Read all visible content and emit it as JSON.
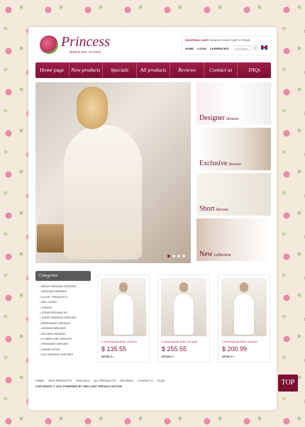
{
  "logo": {
    "name": "Princess",
    "tagline": "WEDDING STORE"
  },
  "cart": {
    "label": "SHOPPING CART:",
    "status": " NOW IN YOUR CART 0 ITEMS",
    "links": [
      "HOME",
      "LOGIN",
      "CURRENCIES"
    ],
    "currency_value": "US Dollar",
    "currency_arrow": "▾"
  },
  "nav": [
    "Home page",
    "New products",
    "Specials",
    "All products",
    "Reviews",
    "Contact us",
    "FAQs"
  ],
  "promos": [
    {
      "title": "Designer",
      "sub": "dresses"
    },
    {
      "title": "Exclusive",
      "sub": "dresses"
    },
    {
      "title": "Short",
      "sub": "dresses"
    },
    {
      "title": "New",
      "sub": "collection"
    }
  ],
  "slider": {
    "dots": 4,
    "active": 0
  },
  "categories": {
    "title": "Categories",
    "items": [
      "BEACH WEDDING DRESSES",
      "WEDDING DRESSES",
      "A-LINE / PRINCESS &",
      "BALL GOWN",
      "SHEATH",
      "STRAPLESS/HALTER",
      "SHORT WEDDING DRESSES",
      "BRIDESMAID DRESSES",
      "EVENING DRESSES",
      "MOTHER DRESSES",
      "FLOWER GIRL DRESSES",
      "PREGNANT DRESSES",
      "GRAND STOCK",
      "2011 WEDDING DRESSES"
    ]
  },
  "products": [
    {
      "desc": "Lorem ipsum dolor sit amet",
      "price": "$ 135.55",
      "details": "DETAILS »"
    },
    {
      "desc": "Lorem ipsum dolor sit amet",
      "price": "$ 255.55",
      "details": "DETAILS »"
    },
    {
      "desc": "Lorem ipsum dolor sit amet",
      "price": "$ 200.99",
      "details": "DETAILS »"
    }
  ],
  "footer": {
    "links": [
      "HOME",
      "NEW PRODUCTS",
      "SPECIALS",
      "ALL PRODUCTS",
      "REVIEWS",
      "CONTACTS",
      "FAQS"
    ],
    "copyright": "COPYRIGHT © 2011 POWERED BY ZEN CART PRIVACY NOTICE"
  },
  "top_button": "TOP",
  "colors": {
    "accent": "#8e1a3d",
    "nav": "#7c1032",
    "background": "#f3eadc"
  }
}
